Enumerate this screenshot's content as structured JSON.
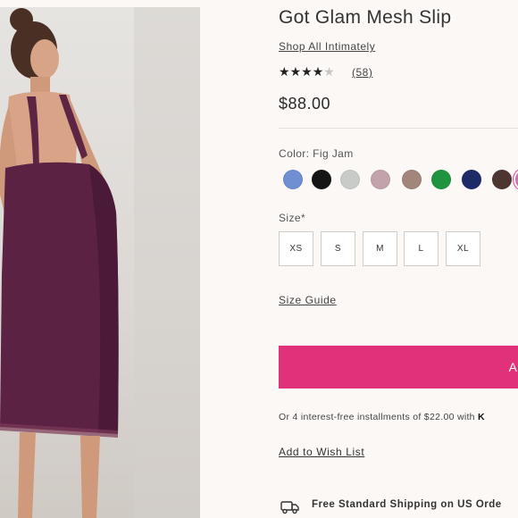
{
  "product": {
    "title": "Got Glam Mesh Slip",
    "collection_link": "Shop All Intimately",
    "rating": 4,
    "rating_max": 5,
    "review_count": "(58)",
    "price": "$88.00"
  },
  "color": {
    "label": "Color: Fig Jam",
    "swatches": [
      {
        "name": "blue",
        "hex": "#6f8fd2"
      },
      {
        "name": "black",
        "hex": "#151515"
      },
      {
        "name": "silver",
        "hex": "#c9cbc8"
      },
      {
        "name": "mauve",
        "hex": "#c2a2ab"
      },
      {
        "name": "taupe",
        "hex": "#a2857b"
      },
      {
        "name": "green",
        "hex": "#1f9440"
      },
      {
        "name": "navy",
        "hex": "#1f2b66"
      },
      {
        "name": "brown",
        "hex": "#4d3532"
      },
      {
        "name": "pink",
        "hex": "#e06fb5"
      }
    ]
  },
  "size": {
    "label": "Size*",
    "options": [
      "XS",
      "S",
      "M",
      "L",
      "XL"
    ],
    "guide_link": "Size Guide"
  },
  "cart": {
    "add_button_label": "A",
    "accent_color": "#e0317a"
  },
  "installments": {
    "text": "Or 4 interest-free installments of $22.00 with ",
    "provider": "K"
  },
  "wishlist_link": "Add to Wish List",
  "shipping": {
    "icon": "truck-icon",
    "text": "Free Standard Shipping on US Orde"
  }
}
